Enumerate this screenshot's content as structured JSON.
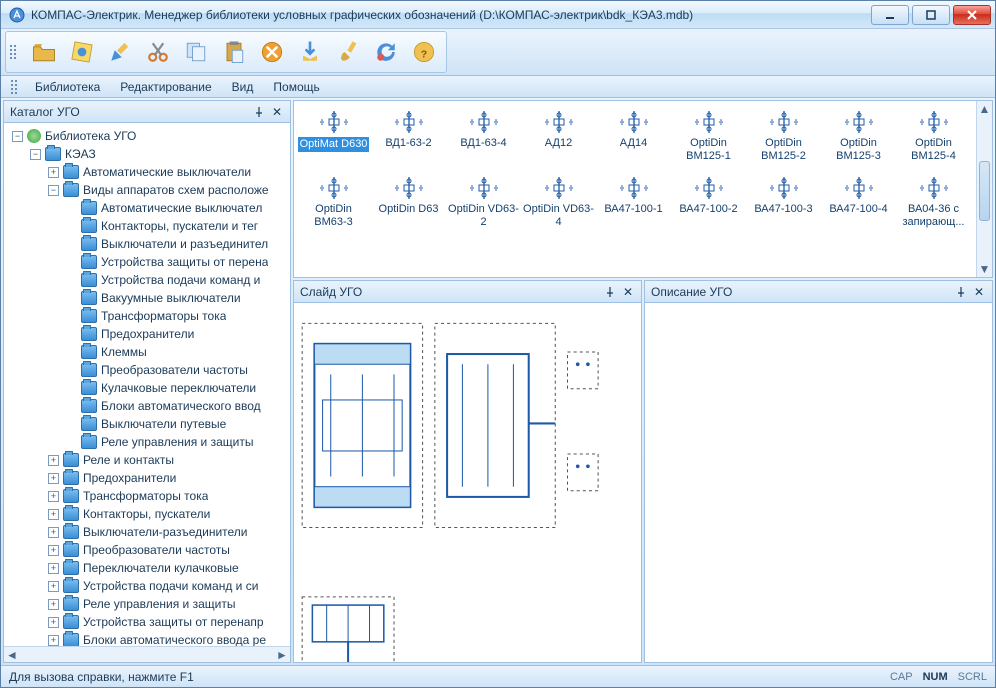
{
  "titlebar": {
    "title": "КОМПАС-Электрик. Менеджер библиотеки условных графических обозначений (D:\\КОМПАС-электрик\\bdk_КЭА3.mdb)"
  },
  "menu": {
    "items": [
      "Библиотека",
      "Редактирование",
      "Вид",
      "Помощь"
    ]
  },
  "toolbar_icons": [
    "open-folder",
    "open-special",
    "edit-pencil",
    "cut",
    "copy",
    "paste",
    "delete",
    "export",
    "brush",
    "refresh",
    "help"
  ],
  "left_panel": {
    "title": "Каталог УГО",
    "root": "Библиотека УГО",
    "brand": "КЭАЗ",
    "top_folders": [
      "Автоматические выключатели",
      "Виды аппаратов схем расположе"
    ],
    "sub_folders": [
      "Автоматические выключател",
      "Контакторы, пускатели и тег",
      "Выключатели и разъединител",
      "Устройства защиты от перена",
      "Устройства подачи команд и",
      "Вакуумные выключатели",
      "Трансформаторы тока",
      "Предохранители",
      "Клеммы",
      "Преобразователи частоты",
      "Кулачковые переключатели",
      "Блоки автоматического ввод",
      "Выключатели путевые",
      "Реле управления и защиты"
    ],
    "lower_folders": [
      "Реле и контакты",
      "Предохранители",
      "Трансформаторы тока",
      "Контакторы, пускатели",
      "Выключатели-разъединители",
      "Преобразователи частоты",
      "Переключатели кулачковые",
      "Устройства подачи команд и си",
      "Реле управления и защиты",
      "Устройства защиты от перенапр",
      "Блоки автоматического ввода ре"
    ]
  },
  "grid": {
    "rows": [
      [
        "OptiMat D630",
        "ВД1-63-2",
        "ВД1-63-4",
        "АД12",
        "АД14",
        "OptiDin BM125-1",
        "OptiDin BM125-2",
        "OptiDin BM125-3",
        "OptiDin BM125-4"
      ],
      [
        "OptiDin BM63-3",
        "OptiDin D63",
        "OptiDin VD63-2",
        "OptiDin VD63-4",
        "ВА47-100-1",
        "ВА47-100-2",
        "ВА47-100-3",
        "ВА47-100-4",
        "ВА04-36 с запирающ..."
      ]
    ],
    "selected": "OptiMat D630"
  },
  "slide_panel": {
    "title": "Слайд УГО"
  },
  "desc_panel": {
    "title": "Описание УГО"
  },
  "statusbar": {
    "hint": "Для вызова справки, нажмите F1",
    "caps": "CAP",
    "num": "NUM",
    "scrl": "SCRL"
  }
}
